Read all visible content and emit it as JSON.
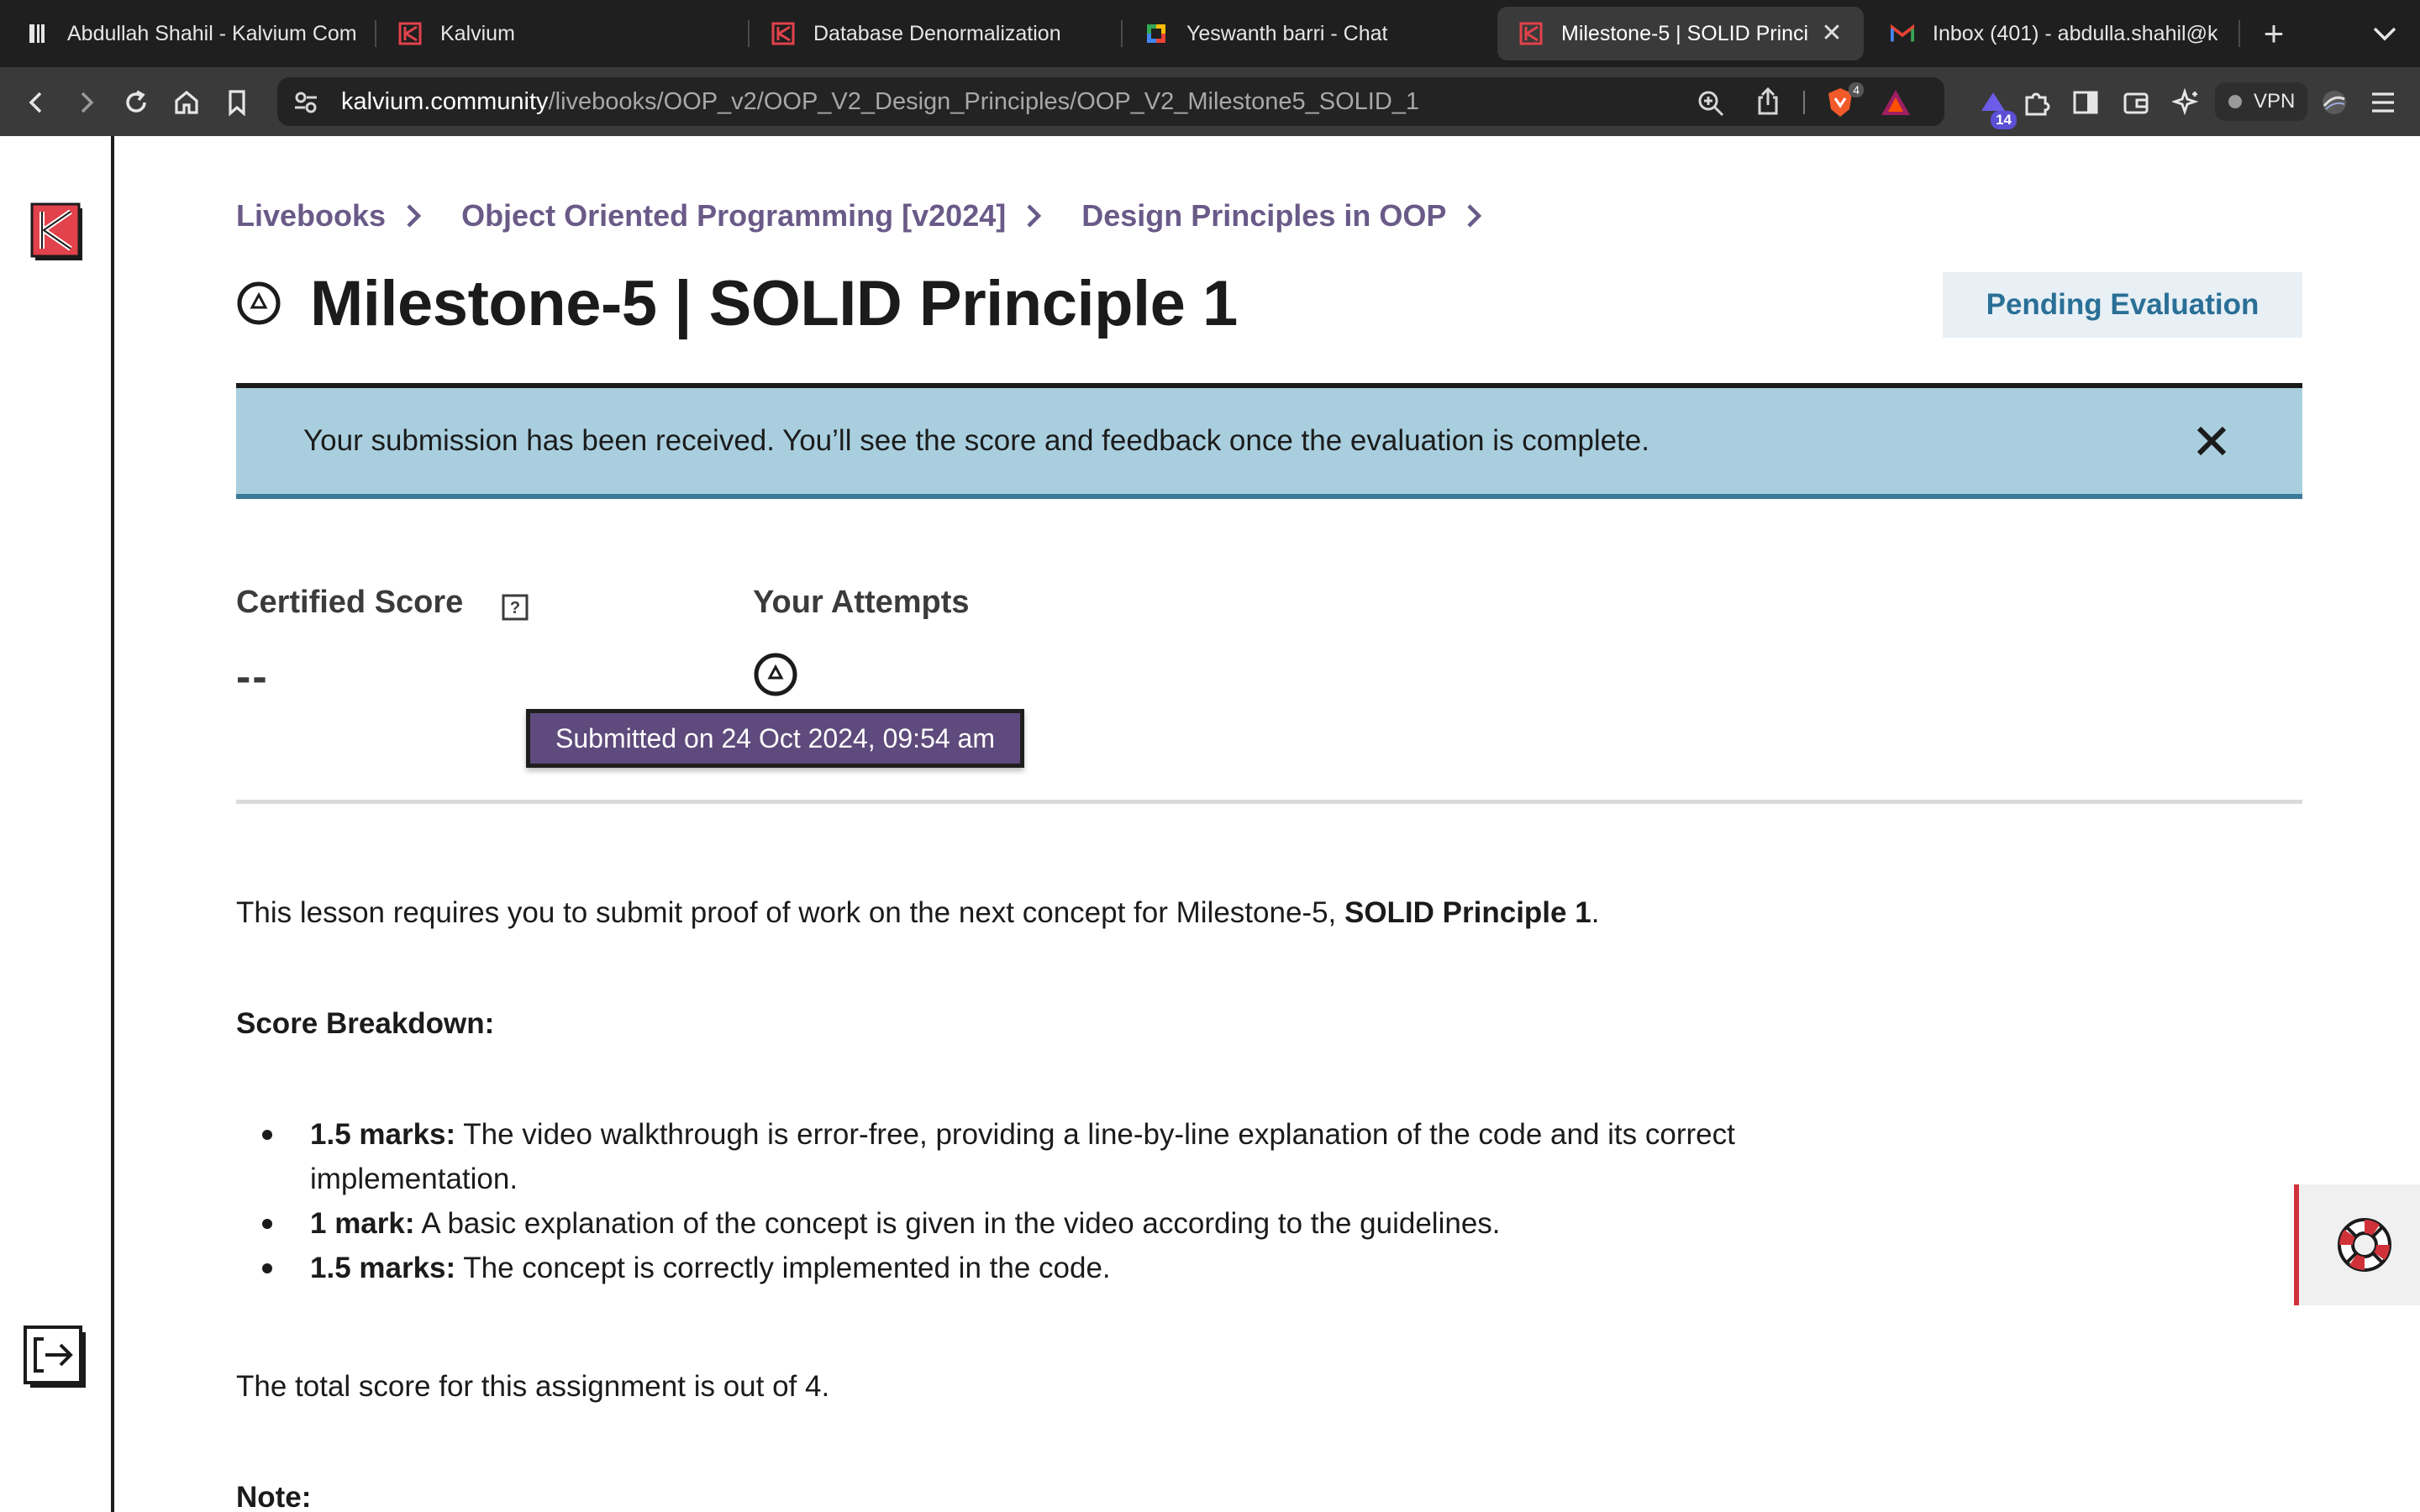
{
  "browser": {
    "tabs": [
      {
        "title": "Abdullah Shahil - Kalvium Com",
        "icon": "document-icon",
        "active": false
      },
      {
        "title": "Kalvium",
        "icon": "kalvium-icon",
        "active": false
      },
      {
        "title": "Database Denormalization",
        "icon": "kalvium-icon",
        "active": false
      },
      {
        "title": "Yeswanth barri - Chat",
        "icon": "chat-icon",
        "active": false
      },
      {
        "title": "Milestone-5 | SOLID Princi",
        "icon": "kalvium-icon",
        "active": true
      },
      {
        "title": "Inbox (401) - abdulla.shahil@k",
        "icon": "gmail-icon",
        "active": false
      }
    ],
    "url_host": "kalvium.community",
    "url_path": "/livebooks/OOP_v2/OOP_V2_Design_Principles/OOP_V2_Milestone5_SOLID_1",
    "brave_shield_count": "4",
    "extension_badge": "14",
    "vpn_label": "VPN"
  },
  "breadcrumb": [
    "Livebooks",
    "Object Oriented Programming [v2024]",
    "Design Principles in OOP"
  ],
  "page": {
    "title": "Milestone-5 | SOLID Principle 1",
    "status": "Pending Evaluation",
    "banner": "Your submission has been received. You’ll see the score and feedback once the evaluation is complete.",
    "certified_score_label": "Certified Score",
    "certified_score_value": "--",
    "attempts_label": "Your Attempts",
    "attempt_tooltip": "Submitted on 24 Oct 2024, 09:54 am"
  },
  "content": {
    "intro_prefix": "This lesson requires you to submit proof of work on the next concept for Milestone-5, ",
    "intro_bold": "SOLID Principle 1",
    "intro_suffix": ".",
    "breakdown_heading": "Score Breakdown:",
    "breakdown": [
      {
        "marks": "1.5 marks:",
        "line1": " The video walkthrough is error-free, providing a line-by-line explanation of the code and its correct",
        "line2": "implementation."
      },
      {
        "marks": "1 mark:",
        "line1": " A basic explanation of the concept is given in the video according to the guidelines.",
        "line2": ""
      },
      {
        "marks": "1.5 marks:",
        "line1": " The concept is correctly implemented in the code.",
        "line2": ""
      }
    ],
    "total": "The total score for this assignment is out of 4.",
    "note_heading": "Note:"
  },
  "colors": {
    "accent_purple": "#6a5a88",
    "banner_blue": "#a9cfdf",
    "status_text": "#2a6f96",
    "kalvium_red": "#d0323a"
  }
}
